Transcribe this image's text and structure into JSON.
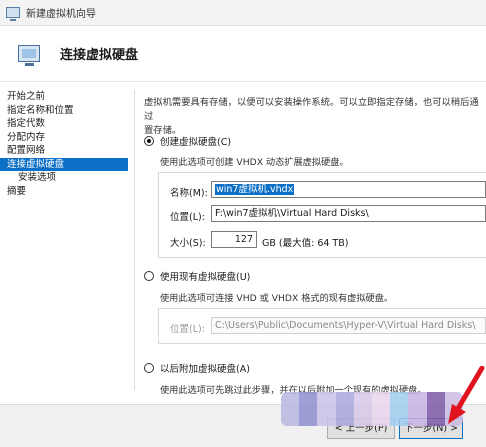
{
  "window": {
    "title": "新建虚拟机向导"
  },
  "header": {
    "title": "连接虚拟硬盘"
  },
  "sidebar": {
    "items": [
      {
        "label": "开始之前"
      },
      {
        "label": "指定名称和位置"
      },
      {
        "label": "指定代数"
      },
      {
        "label": "分配内存"
      },
      {
        "label": "配置网络"
      },
      {
        "label": "连接虚拟硬盘"
      },
      {
        "label": "安装选项"
      },
      {
        "label": "摘要"
      }
    ],
    "active_index": 5
  },
  "content": {
    "intro_line1": "虚拟机需要具有存储，以便可以安装操作系统。可以立即指定存储，也可以稍后通过",
    "intro_line2": "置存储。",
    "option_create": {
      "label": "创建虚拟硬盘(C)",
      "description": "使用此选项可创建 VHDX 动态扩展虚拟硬盘。",
      "selected": true,
      "name_label": "名称(M):",
      "name_value": "win7虚拟机.vhdx",
      "location_label": "位置(L):",
      "location_value": "F:\\win7虚拟机\\Virtual Hard Disks\\",
      "size_label": "大小(S):",
      "size_value": "127",
      "size_unit": "GB (最大值: 64 TB)"
    },
    "option_existing": {
      "label": "使用现有虚拟硬盘(U)",
      "description": "使用此选项可连接 VHD 或 VHDX 格式的现有虚拟硬盘。",
      "selected": false,
      "location_label": "位置(L):",
      "location_value": "C:\\Users\\Public\\Documents\\Hyper-V\\Virtual Hard Disks\\"
    },
    "option_later": {
      "label": "以后附加虚拟硬盘(A)",
      "description": "使用此选项可先跳过此步骤，并在以后附加一个现有的虚拟硬盘。",
      "selected": false
    }
  },
  "footer": {
    "prev_label": "< 上一步(P)",
    "next_label": "下一步(N) >"
  },
  "colors": {
    "accent": "#0c6fc6",
    "annotation_arrow": "#e0141e"
  }
}
